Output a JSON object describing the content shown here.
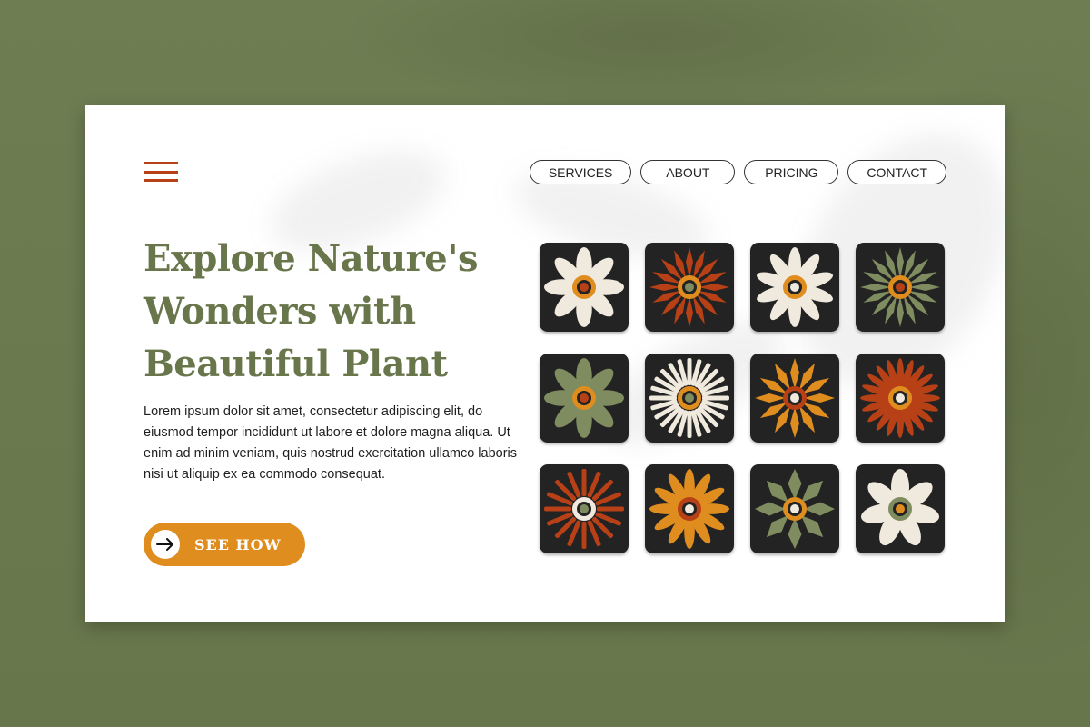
{
  "colors": {
    "background": "#6b7a4f",
    "card": "#ffffff",
    "accent_orange": "#e08d1f",
    "accent_rust": "#b84016",
    "olive": "#69764b",
    "cream": "#efe9de",
    "tile_bg": "#232323"
  },
  "header": {
    "menu_icon": "hamburger-menu-icon",
    "nav": [
      {
        "label": "SERVICES"
      },
      {
        "label": "ABOUT"
      },
      {
        "label": "PRICING"
      },
      {
        "label": "CONTACT"
      }
    ]
  },
  "hero": {
    "title": "Explore Nature's Wonders with Beautiful Plant",
    "body": "Lorem ipsum dolor sit amet, consectetur adipiscing elit, do eiusmod tempor incididunt ut labore et dolore magna aliqua. Ut enim ad minim veniam, quis nostrud exercitation ullamco laboris nisi ut aliquip ex ea commodo consequat.",
    "cta_label": "SEE HOW",
    "cta_icon": "arrow-right-icon"
  },
  "flower_grid": [
    {
      "petals": 8,
      "style": "round",
      "petal_color": "#efe9de",
      "ring_color": "#e08d1f",
      "center_color": "#b84016"
    },
    {
      "petals": 16,
      "style": "pointed",
      "petal_color": "#b84016",
      "ring_color": "#e08d1f",
      "center_color": "#7f8c5f"
    },
    {
      "petals": 10,
      "style": "round",
      "petal_color": "#efe9de",
      "ring_color": "#e08d1f",
      "center_color": "#efe9de"
    },
    {
      "petals": 16,
      "style": "pointed",
      "petal_color": "#7f8c5f",
      "ring_color": "#e08d1f",
      "center_color": "#b84016"
    },
    {
      "petals": 8,
      "style": "round",
      "petal_color": "#7f8c5f",
      "ring_color": "#e08d1f",
      "center_color": "#b84016"
    },
    {
      "petals": 24,
      "style": "thin",
      "petal_color": "#efe9de",
      "ring_color": "#e08d1f",
      "center_color": "#7f8c5f"
    },
    {
      "petals": 12,
      "style": "pointed",
      "petal_color": "#e08d1f",
      "ring_color": "#b84016",
      "center_color": "#efe9de"
    },
    {
      "petals": 20,
      "style": "round",
      "petal_color": "#b84016",
      "ring_color": "#e08d1f",
      "center_color": "#efe9de"
    },
    {
      "petals": 16,
      "style": "thin",
      "petal_color": "#b84016",
      "ring_color": "#efe9de",
      "center_color": "#7f8c5f"
    },
    {
      "petals": 12,
      "style": "round",
      "petal_color": "#e08d1f",
      "ring_color": "#b84016",
      "center_color": "#efe9de"
    },
    {
      "petals": 8,
      "style": "pointed",
      "petal_color": "#7f8c5f",
      "ring_color": "#e08d1f",
      "center_color": "#efe9de"
    },
    {
      "petals": 7,
      "style": "round",
      "petal_color": "#efe9de",
      "ring_color": "#7f8c5f",
      "center_color": "#e08d1f"
    }
  ]
}
